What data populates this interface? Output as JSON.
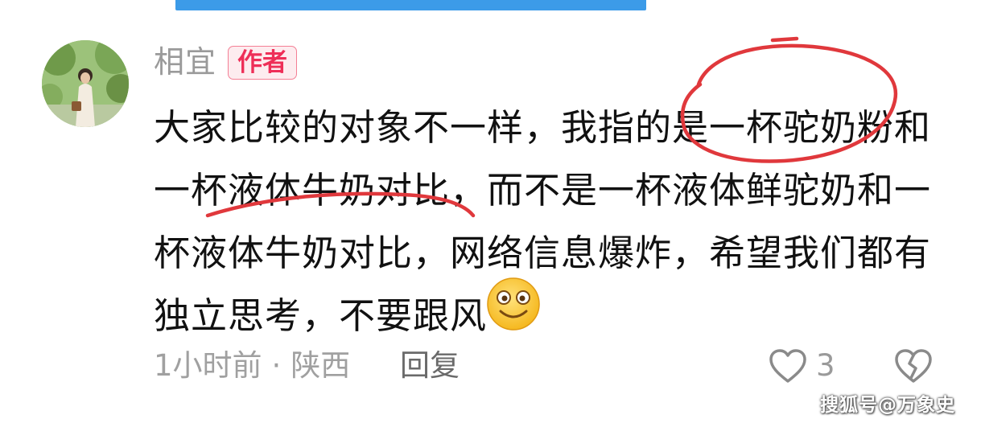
{
  "comment": {
    "username": "相宜",
    "badge": "作者",
    "lines": [
      "大家比较的对象不一样，我指的是一杯驼奶粉和",
      "一杯液体牛奶对比，而不是一杯液体鲜驼奶和一",
      "杯液体牛奶对比，网络信息爆炸，希望我们都有",
      "独立思考，不要跟风"
    ],
    "emoji": "smile-emoji",
    "time": "1小时前",
    "separator": "·",
    "location": "陕西",
    "reply_label": "回复",
    "like_count": "3"
  },
  "colors": {
    "badge_text": "#ee2f58",
    "annotation": "#e0383c",
    "top_bar": "#3c9be8"
  },
  "watermark": "搜狐号@万象史"
}
